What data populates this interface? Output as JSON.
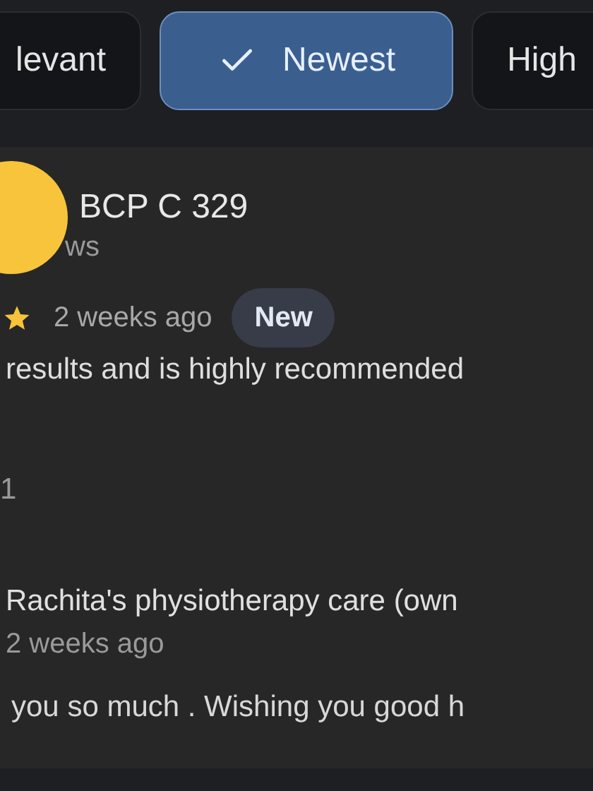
{
  "sort_chips": [
    {
      "label": "levant",
      "selected": false
    },
    {
      "label": "Newest",
      "selected": true
    },
    {
      "label": "High",
      "selected": false
    }
  ],
  "review": {
    "author": "BCP C 329",
    "subtitle": "ws",
    "time": "2 weeks ago",
    "badge": "New",
    "text": "results and is highly recommended",
    "likes": "1",
    "owner_reply": {
      "author": "Rachita's physiotherapy care (own",
      "time": "2 weeks ago",
      "text": "you so much . Wishing you good h"
    }
  }
}
